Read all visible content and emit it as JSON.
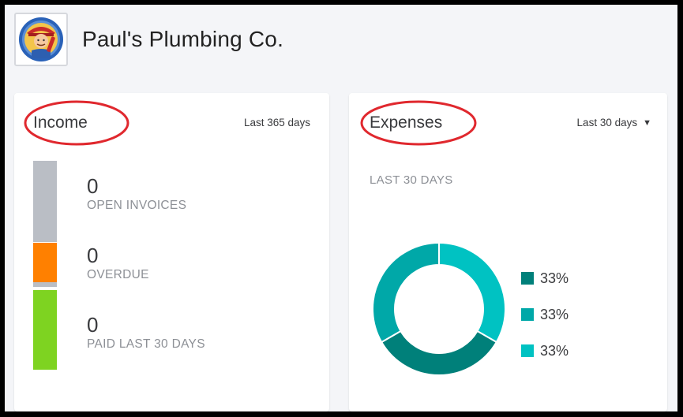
{
  "company": {
    "name": "Paul's Plumbing Co."
  },
  "income": {
    "title": "Income",
    "period": "Last 365 days",
    "stats": [
      {
        "value": "0",
        "label": "OPEN INVOICES"
      },
      {
        "value": "0",
        "label": "OVERDUE"
      },
      {
        "value": "0",
        "label": "PAID LAST 30 DAYS"
      }
    ],
    "colors": {
      "open": "#babec5",
      "overdue": "#ff8000",
      "paid": "#7ed321"
    }
  },
  "expenses": {
    "title": "Expenses",
    "period": "Last 30 days",
    "period_icon": "caret-down-icon",
    "subtitle": "LAST 30 DAYS",
    "chart_data": {
      "type": "pie",
      "categories": [
        "",
        "",
        ""
      ],
      "values": [
        33,
        33,
        33
      ],
      "colors": [
        "#00807a",
        "#00a8a8",
        "#00c2c2"
      ],
      "labels": [
        "33%",
        "33%",
        "33%"
      ]
    }
  },
  "annotation_color": "#e0282e"
}
